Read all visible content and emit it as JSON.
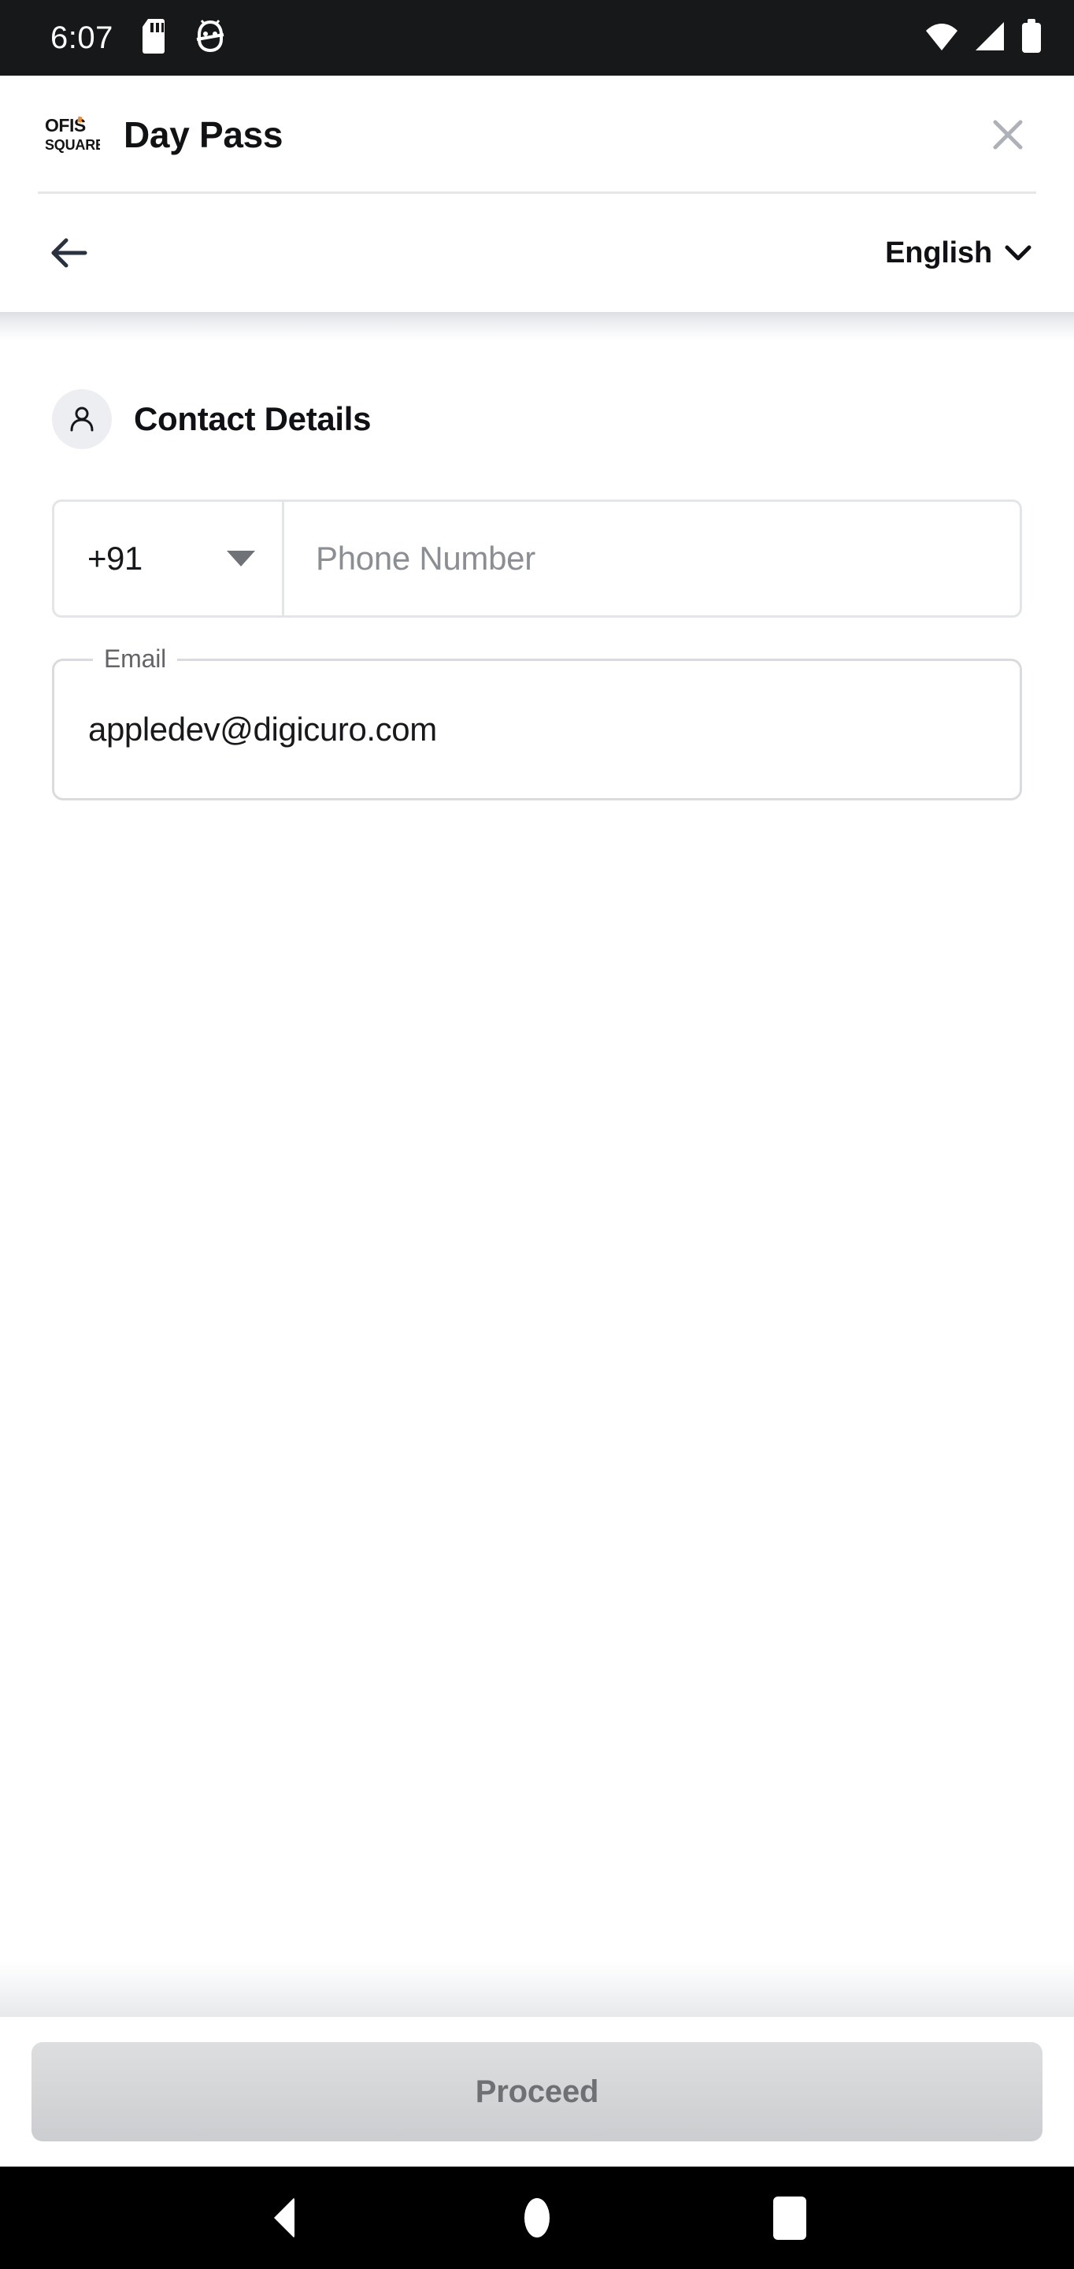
{
  "status_bar": {
    "time": "6:07",
    "left_icons": [
      "sd-card-icon",
      "android-debug-icon"
    ],
    "right_icons": [
      "wifi-icon",
      "cellular-signal-icon",
      "battery-icon"
    ],
    "background": "#17181a"
  },
  "app_bar": {
    "logo_line1": "OFIS",
    "logo_line2": "SQUARE",
    "logo_accent_color": "#f08a24",
    "title": "Day Pass",
    "close_icon": "close-icon"
  },
  "language_bar": {
    "back_icon": "arrow-left-icon",
    "language": "English",
    "chevron_icon": "chevron-down-icon"
  },
  "contact_section": {
    "icon": "person-icon",
    "title": "Contact Details",
    "country_code": {
      "value": "+91",
      "caret_icon": "caret-down-icon"
    },
    "phone": {
      "value": "",
      "placeholder": "Phone Number"
    },
    "email": {
      "label": "Email",
      "value": "appledev@digicuro.com",
      "placeholder": ""
    }
  },
  "footer": {
    "proceed_label": "Proceed",
    "proceed_disabled": true
  },
  "nav_bar": {
    "back": "nav-back-icon",
    "home": "nav-home-icon",
    "recents": "nav-recents-icon"
  },
  "colors": {
    "accent": "#f08a24",
    "text_primary": "#101114",
    "text_muted": "#8b8e93",
    "border": "#e3e5e8",
    "surface": "#ffffff"
  }
}
